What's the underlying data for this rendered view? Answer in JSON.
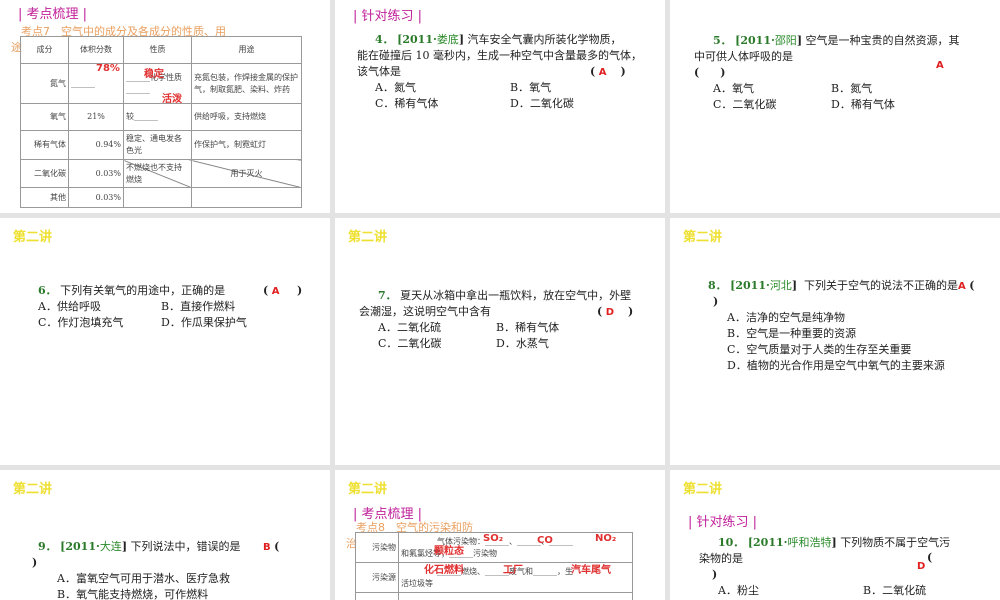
{
  "slides": [
    {
      "header": "| 考点梳理 |",
      "topic": "考点7　空气中的成分及各成分的性质、用",
      "topic_wrap": "途",
      "table": {
        "headers": [
          "成分",
          "体积分数",
          "性质",
          "用途"
        ],
        "rows": [
          {
            "name": "氮气",
            "fraction": "______",
            "fraction_answer": "78%",
            "property": "______化学性质______",
            "property_answer": "稳定",
            "use": "充氮包装，作焊接金属的保护气，制取氮肥、染料、炸药"
          },
          {
            "name": "氧气",
            "fraction": "21%",
            "property": "较______",
            "property_answer": "活泼",
            "use": "供给呼吸，支持燃烧"
          },
          {
            "name": "稀有气体",
            "fraction": "0.94%",
            "property": "稳定、通电发各色光",
            "use": "作保护气，制霓虹灯"
          },
          {
            "name": "二氧化碳",
            "fraction": "0.03%",
            "property": "不燃烧也不支持燃烧",
            "use": "用于灭火"
          },
          {
            "name": "其他",
            "fraction": "0.03%",
            "property": "",
            "use": ""
          }
        ]
      }
    },
    {
      "header": "| 针对练习 |",
      "number": "4．",
      "source_year": "[2011·",
      "source_place": "娄底",
      "source_end": "]",
      "stem": [
        "汽车安全气囊内所装化学物质，",
        "能在碰撞后 10 毫秒内，生成一种空气中含量最多的气体，",
        "该气体是"
      ],
      "answer": "A",
      "options": [
        "A．氮气",
        "B．氧气",
        "C．稀有气体",
        "D．二氧化碳"
      ]
    },
    {
      "number": "5．",
      "source_year": "[2011·",
      "source_place": "邵阳",
      "source_end": "]",
      "stem": [
        "空气是一种宝贵的自然资源，其",
        "中可供人体呼吸的是"
      ],
      "answer": "A",
      "options": [
        "A．氧气",
        "B．氮气",
        "C．二氧化碳",
        "D．稀有气体"
      ]
    },
    {
      "lecture": "第二讲",
      "number": "6．",
      "stem": [
        "下列有关氧气的用途中，正确的是"
      ],
      "answer": "A",
      "options": [
        "A．供给呼吸",
        "B．直接作燃料",
        "C．作灯泡填充气",
        "D．作瓜果保护气"
      ]
    },
    {
      "lecture": "第二讲",
      "number": "7．",
      "stem": [
        "夏天从冰箱中拿出一瓶饮料，放在空气中，外壁",
        "会潮湿，这说明空气中含有"
      ],
      "answer": "D",
      "options": [
        "A．二氧化硫",
        "B．稀有气体",
        "C．二氧化碳",
        "D．水蒸气"
      ]
    },
    {
      "lecture": "第二讲",
      "number": "8．",
      "source_year": "[2011·",
      "source_place": "河北",
      "source_end": "]",
      "stem": [
        "下列关于空气的说法不正确的是"
      ],
      "answer": "A",
      "options": [
        "A．洁净的空气是纯净物",
        "B．空气是一种重要的资源",
        "C．空气质量对于人类的生存至关重要",
        "D．植物的光合作用是空气中氧气的主要来源"
      ]
    },
    {
      "lecture": "第二讲",
      "number": "9．",
      "source_year": "[2011·",
      "source_place": "大连",
      "source_end": "]",
      "stem": [
        "下列说法中，错误的是"
      ],
      "answer": "B",
      "options": [
        "A．富氧空气可用于潜水、医疗急救",
        "B．氧气能支持燃烧，可作燃料"
      ]
    },
    {
      "lecture": "第二讲",
      "header": "| 考点梳理 |",
      "topic": "考点8　空气的污染和防",
      "topic_wrap": "治",
      "table": {
        "rows": [
          {
            "label": "污染物",
            "text1": "气体污染物：______、______、______",
            "answers1": [
              "SO₂",
              "CO",
              "NO₂"
            ],
            "text2": "和氟氯烃等；______污染物",
            "answers2": [
              "颗粒态"
            ]
          },
          {
            "label": "污染源",
            "text1": "______燃烧、______废气和______，生",
            "answers1": [
              "化石燃料",
              "工厂",
              "汽车尾气"
            ],
            "text2": "活垃圾等"
          }
        ]
      }
    },
    {
      "lecture": "第二讲",
      "header": "| 针对练习 |",
      "number": "10．",
      "source_year": "[2011·",
      "source_place": "呼和浩特",
      "source_end": "]",
      "stem": [
        "下列物质不属于空气污",
        "染物的是"
      ],
      "answer": "D",
      "options": [
        "A．粉尘",
        "B．二氧化硫"
      ]
    }
  ],
  "colors": {
    "header": "#c0209a",
    "topic": "#eaa060",
    "lecture": "#eee030",
    "number": "#2a7a2a",
    "answer": "#e02020"
  }
}
